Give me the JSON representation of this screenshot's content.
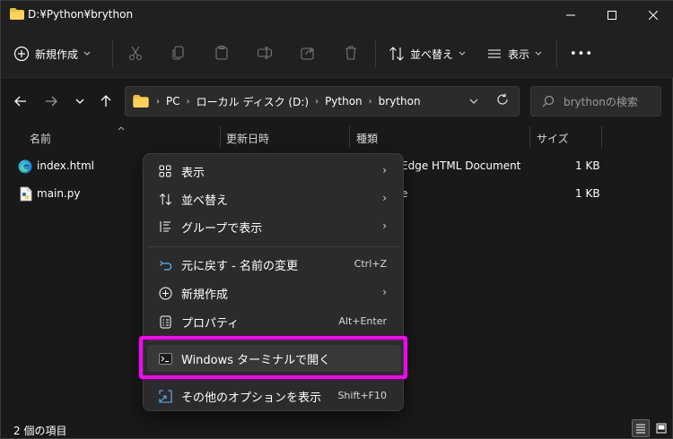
{
  "window": {
    "title": "D:¥Python¥brython",
    "accent": "#ff00ff"
  },
  "toolbar": {
    "new_label": "新規作成",
    "sort_label": "並べ替え",
    "view_label": "表示",
    "more_label": "•••"
  },
  "address": {
    "crumbs": [
      "PC",
      "ローカル ディスク (D:)",
      "Python",
      "brython"
    ]
  },
  "search": {
    "placeholder": "brythonの検索"
  },
  "columns": {
    "name": "名前",
    "modified": "更新日時",
    "type": "種類",
    "size": "サイズ"
  },
  "files": [
    {
      "name": "index.html",
      "type": "Edge HTML Document",
      "size": "1 KB",
      "icon": "edge-icon"
    },
    {
      "name": "main.py",
      "type": "e",
      "size": "1 KB",
      "icon": "python-file-icon"
    }
  ],
  "status": {
    "item_count": "2 個の項目"
  },
  "menu": {
    "items": [
      {
        "label": "表示",
        "shortcut": "",
        "submenu": true,
        "icon": "grid-icon"
      },
      {
        "label": "並べ替え",
        "shortcut": "",
        "submenu": true,
        "icon": "sort-icon"
      },
      {
        "label": "グループで表示",
        "shortcut": "",
        "submenu": true,
        "icon": "group-icon"
      },
      {
        "label": "元に戻す - 名前の変更",
        "shortcut": "Ctrl+Z",
        "submenu": false,
        "icon": "undo-icon"
      },
      {
        "label": "新規作成",
        "shortcut": "",
        "submenu": true,
        "icon": "new-icon"
      },
      {
        "label": "プロパティ",
        "shortcut": "Alt+Enter",
        "submenu": false,
        "icon": "properties-icon"
      },
      {
        "label": "Windows ターミナルで開く",
        "shortcut": "",
        "submenu": false,
        "icon": "terminal-icon"
      },
      {
        "label": "その他のオプションを表示",
        "shortcut": "Shift+F10",
        "submenu": false,
        "icon": "more-options-icon"
      }
    ],
    "arrow": "›"
  }
}
